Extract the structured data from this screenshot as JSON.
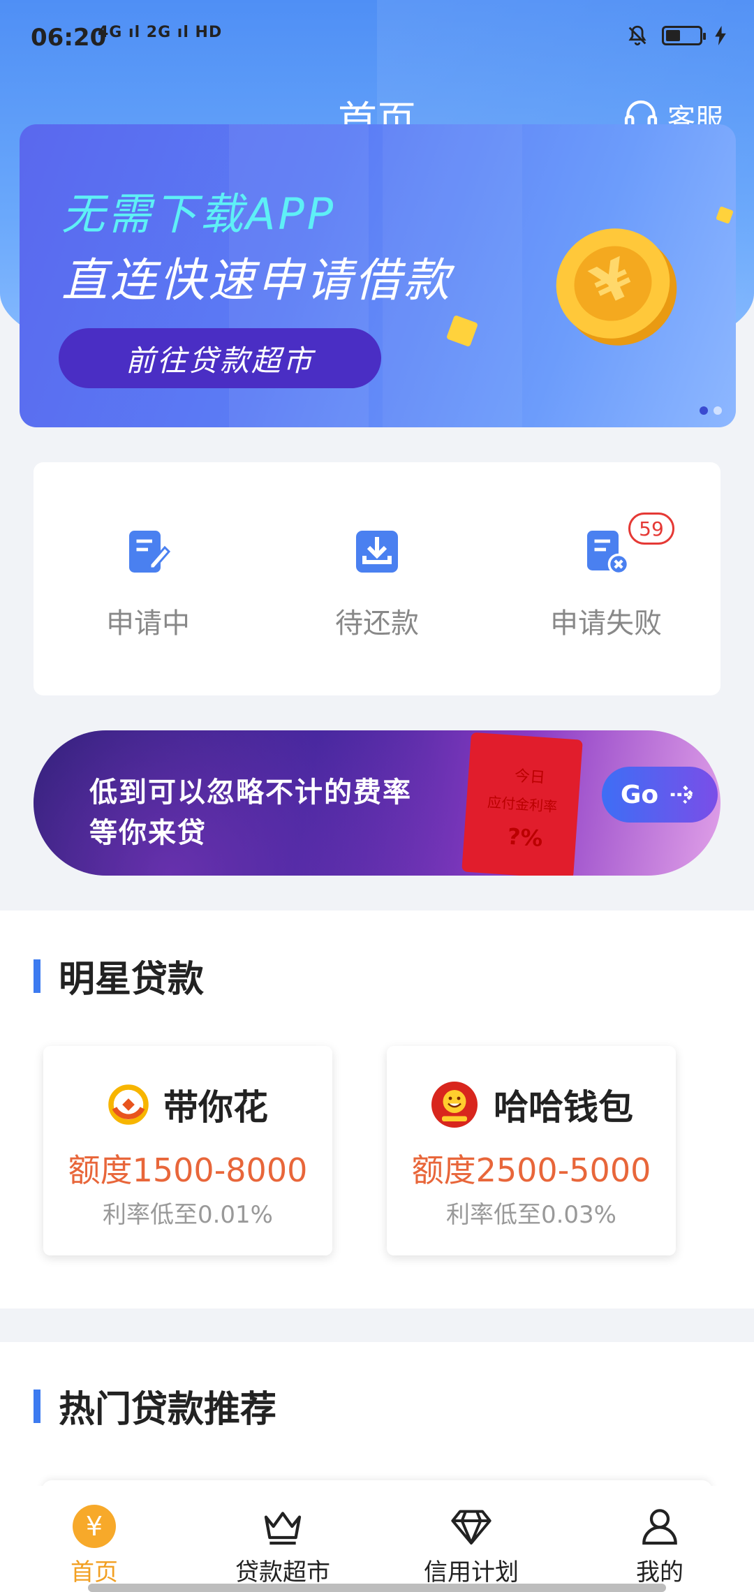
{
  "status": {
    "time": "06:20",
    "signal": "4G ıl 2G ıl HD"
  },
  "header": {
    "title": "首页",
    "customer_service": "客服"
  },
  "banner": {
    "line1": "无需下载APP",
    "line2": "直连快速申请借款",
    "button": "前往贷款超市",
    "coin_symbol": "¥"
  },
  "quick_actions": [
    {
      "label": "申请中",
      "icon": "edit-document-icon"
    },
    {
      "label": "待还款",
      "icon": "download-tray-icon"
    },
    {
      "label": "申请失败",
      "icon": "document-x-icon",
      "badge": "59"
    }
  ],
  "promo": {
    "line1": "低到可以忽略不计的费率",
    "line2": "等你来贷",
    "envelope_title": "今日",
    "envelope_sub": "应付金利率",
    "envelope_mark": "?%",
    "button": "Go"
  },
  "star_loans": {
    "title": "明星贷款",
    "items": [
      {
        "name": "带你花",
        "amount": "额度1500-8000",
        "rate": "利率低至0.01%"
      },
      {
        "name": "哈哈钱包",
        "amount": "额度2500-5000",
        "rate": "利率低至0.03%"
      }
    ]
  },
  "hot_loans": {
    "title": "热门贷款推荐"
  },
  "nav": {
    "items": [
      {
        "label": "首页",
        "icon": "yen-coin-icon"
      },
      {
        "label": "贷款超市",
        "icon": "crown-icon"
      },
      {
        "label": "信用计划",
        "icon": "diamond-icon"
      },
      {
        "label": "我的",
        "icon": "user-icon"
      }
    ]
  },
  "colors": {
    "primary": "#3d7bf0",
    "accent": "#f2a023",
    "amount": "#e8663a",
    "badge": "#e53935"
  }
}
